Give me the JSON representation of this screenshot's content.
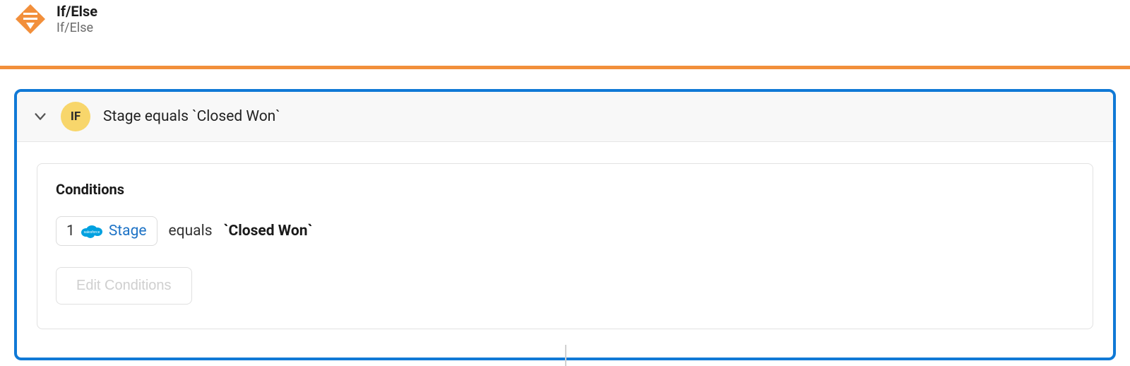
{
  "header": {
    "title": "If/Else",
    "subtitle": "If/Else"
  },
  "branch": {
    "badge": "IF",
    "summary": "Stage equals `Closed Won`"
  },
  "conditions": {
    "title": "Conditions",
    "rows": [
      {
        "index": "1",
        "field": "Stage",
        "operator": "equals",
        "value": "`Closed Won`"
      }
    ],
    "edit_button": "Edit Conditions"
  }
}
